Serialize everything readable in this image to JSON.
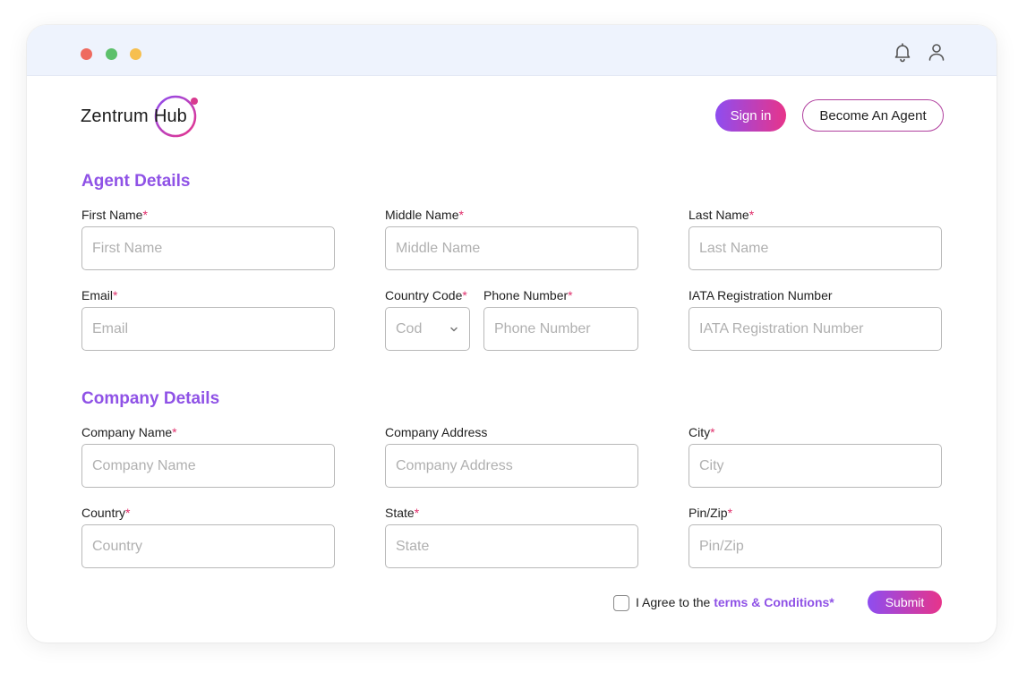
{
  "app": {
    "logo_main": "Zentrum",
    "logo_sub": "Hub"
  },
  "header": {
    "signin_label": "Sign in",
    "agent_label": "Become An Agent"
  },
  "agent_section": {
    "title": "Agent Details",
    "first_name": {
      "label": "First Name",
      "placeholder": "First Name"
    },
    "middle_name": {
      "label": "Middle Name",
      "placeholder": "Middle Name"
    },
    "last_name": {
      "label": "Last Name",
      "placeholder": "Last Name"
    },
    "email": {
      "label": "Email",
      "placeholder": "Email"
    },
    "country_code": {
      "label": "Country Code",
      "value": "Cod"
    },
    "phone": {
      "label": "Phone Number",
      "placeholder": "Phone Number"
    },
    "iata": {
      "label": "IATA Registration Number",
      "placeholder": "IATA Registration Number"
    }
  },
  "company_section": {
    "title": "Company Details",
    "company_name": {
      "label": "Company Name",
      "placeholder": "Company Name"
    },
    "company_address": {
      "label": "Company Address",
      "placeholder": "Company Address"
    },
    "city": {
      "label": "City",
      "placeholder": "City"
    },
    "country": {
      "label": "Country",
      "placeholder": "Country"
    },
    "state": {
      "label": "State",
      "placeholder": "State"
    },
    "pin": {
      "label": "Pin/Zip",
      "placeholder": "Pin/Zip"
    }
  },
  "footer": {
    "agree_prefix": "I Agree to the",
    "agree_link": "terms & Conditions*",
    "submit_label": "Submit"
  },
  "colors": {
    "accent": "#8f52e6",
    "gradient_start": "#8e4df0",
    "gradient_end": "#e7348a",
    "required": "#e0306c"
  },
  "icons": {
    "bell": "bell-icon",
    "user": "user-icon",
    "chevron": "chevron-down-icon"
  }
}
